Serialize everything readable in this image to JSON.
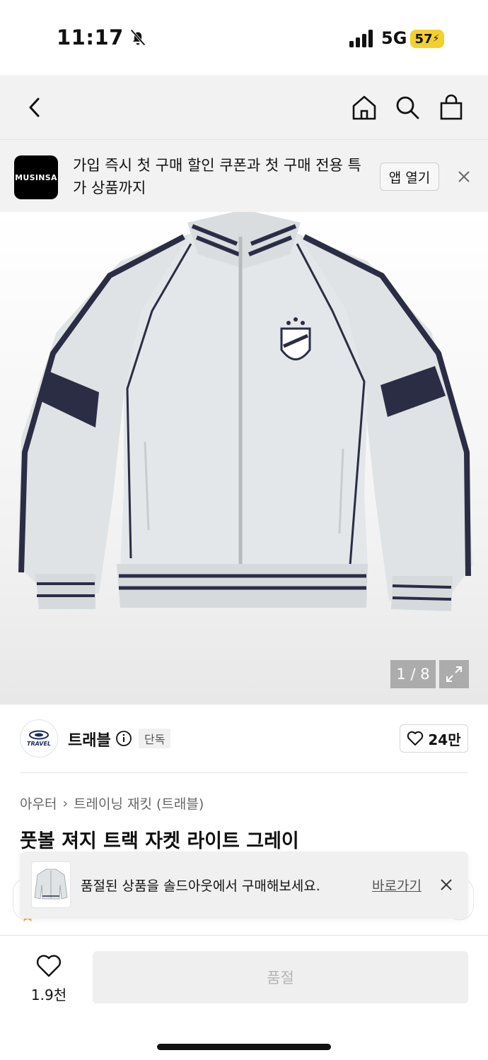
{
  "status_bar": {
    "time": "11:17",
    "network": "5G",
    "battery": "57",
    "icons": [
      "bell-off-icon",
      "signal-icon",
      "battery-charging-icon"
    ]
  },
  "nav": {
    "icons": [
      "back-icon",
      "home-icon",
      "search-icon",
      "shopping-bag-icon"
    ]
  },
  "banner": {
    "logo_text": "MUSINSA",
    "message": "가입 즉시 첫 구매 할인 쿠폰과 첫 구매 전용 특가 상품까지",
    "open_app_label": "앱 열기"
  },
  "gallery": {
    "counter": "1 / 8"
  },
  "brand": {
    "logo_text": "TRAVEL",
    "name": "트래블",
    "exclusive_badge": "단독",
    "like_count": "24만"
  },
  "product": {
    "breadcrumb": [
      "아우터",
      "트레이닝 재킷 (트래블)"
    ],
    "title": "풋볼 져지 트랙 자켓 라이트 그레이"
  },
  "toast": {
    "message": "품절된 상품을 솔드아웃에서 구매해보세요.",
    "link_label": "바로가기"
  },
  "bottom_bar": {
    "wish_count": "1.9천",
    "buy_button_label": "품절"
  },
  "colors": {
    "jacket_body": "#dfe3e5",
    "jacket_trim": "#2b2d45",
    "battery": "#f4d02b",
    "link_blue": "#2255dd"
  }
}
